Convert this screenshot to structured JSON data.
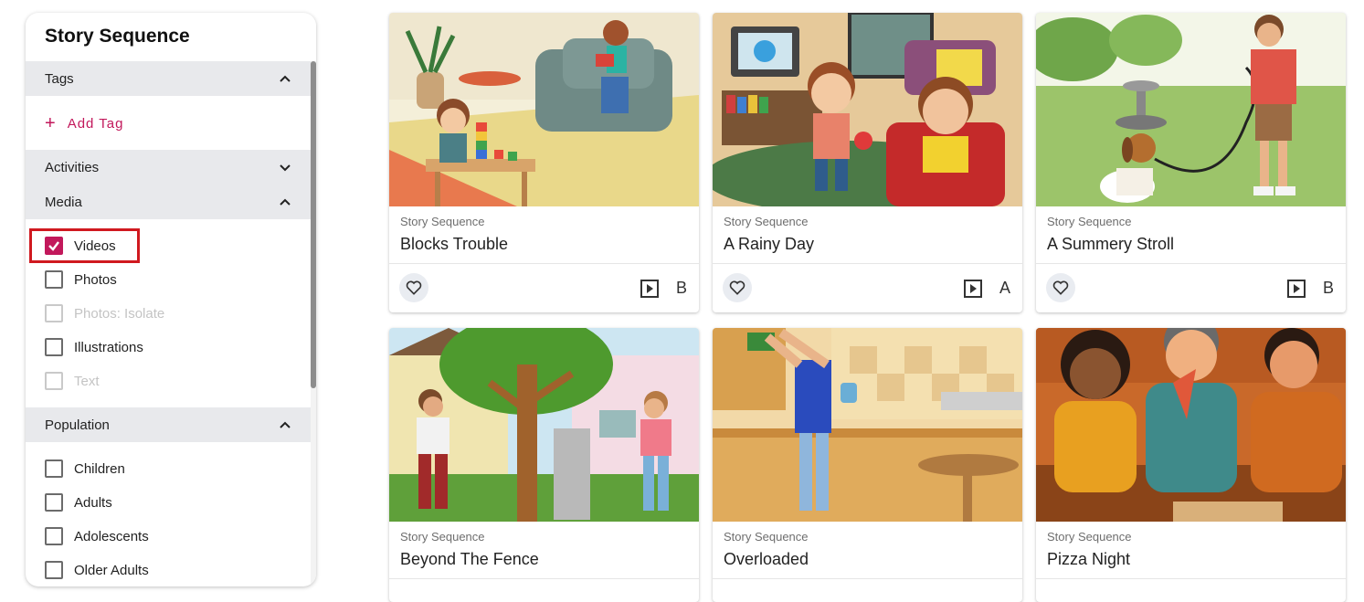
{
  "sidebar": {
    "title": "Story Sequence",
    "sections": {
      "tags": {
        "label": "Tags",
        "expanded": true,
        "add_label": "Add Tag"
      },
      "activities": {
        "label": "Activities",
        "expanded": false
      },
      "media": {
        "label": "Media",
        "expanded": true,
        "options": [
          {
            "label": "Videos",
            "checked": true,
            "disabled": false
          },
          {
            "label": "Photos",
            "checked": false,
            "disabled": false
          },
          {
            "label": "Photos: Isolate",
            "checked": false,
            "disabled": true
          },
          {
            "label": "Illustrations",
            "checked": false,
            "disabled": false
          },
          {
            "label": "Text",
            "checked": false,
            "disabled": true
          }
        ]
      },
      "population": {
        "label": "Population",
        "expanded": true,
        "options": [
          {
            "label": "Children",
            "checked": false
          },
          {
            "label": "Adults",
            "checked": false
          },
          {
            "label": "Adolescents",
            "checked": false
          },
          {
            "label": "Older Adults",
            "checked": false
          }
        ]
      }
    }
  },
  "cards": [
    {
      "category": "Story Sequence",
      "title": "Blocks Trouble",
      "level": "B",
      "scene": "living room with child stacking blocks and girl reading on sofa"
    },
    {
      "category": "Story Sequence",
      "title": "A Rainy Day",
      "level": "A",
      "scene": "two boys indoors on a rainy day"
    },
    {
      "category": "Story Sequence",
      "title": "A Summery Stroll",
      "level": "B",
      "scene": "man walking a beagle in a park"
    },
    {
      "category": "Story Sequence",
      "title": "Beyond The Fence",
      "level": "",
      "scene": "neighbours talking over a fence near a tree"
    },
    {
      "category": "Story Sequence",
      "title": "Overloaded",
      "level": "",
      "scene": "man reaching into a kitchen cabinet"
    },
    {
      "category": "Story Sequence",
      "title": "Pizza Night",
      "level": "",
      "scene": "three people eating pizza on a couch"
    }
  ],
  "colors": {
    "accent": "#c2185b",
    "highlight": "#d0191f",
    "section_bg": "#e8e9ec"
  },
  "icons": {
    "favorite": "heart-icon",
    "media": "play-icon",
    "collapse": "chevron-up-icon",
    "expand": "chevron-down-icon",
    "add": "plus-icon"
  }
}
